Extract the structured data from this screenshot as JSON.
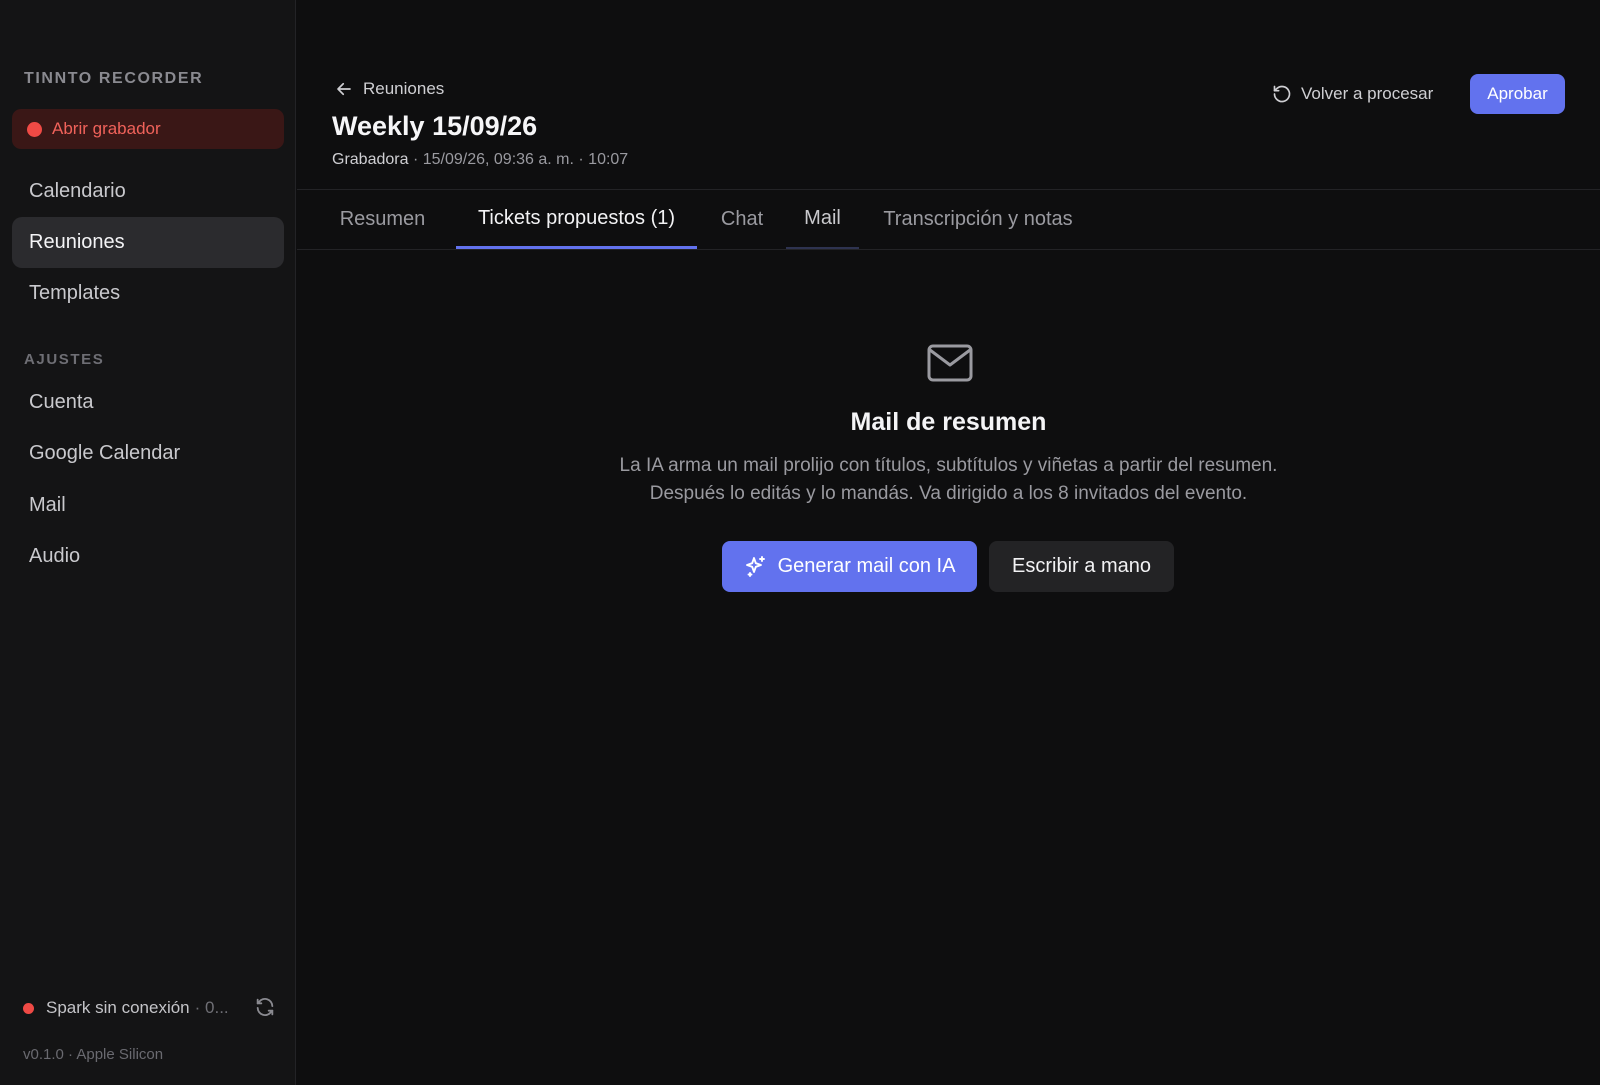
{
  "sidebar": {
    "brand": "TINNTO RECORDER",
    "record_button": "Abrir grabador",
    "nav": [
      {
        "label": "Calendario"
      },
      {
        "label": "Reuniones"
      },
      {
        "label": "Templates"
      }
    ],
    "settings_label": "AJUSTES",
    "settings": [
      {
        "label": "Cuenta"
      },
      {
        "label": "Google Calendar"
      },
      {
        "label": "Mail"
      },
      {
        "label": "Audio"
      }
    ],
    "status": {
      "text": "Spark sin conexión",
      "extra": "· 0..."
    },
    "version": "v0.1.0 · Apple Silicon",
    "active_item": "Reuniones"
  },
  "header": {
    "back_label": "Reuniones",
    "title": "Weekly 15/09/26",
    "meta_source": "Grabadora",
    "meta_rest": "· 15/09/26, 09:36 a. m. · 10:07",
    "reprocess_label": "Volver a procesar",
    "approve_label": "Aprobar"
  },
  "tabs": [
    {
      "label": "Resumen"
    },
    {
      "label": "Tickets propuestos (1)"
    },
    {
      "label": "Chat"
    },
    {
      "label": "Mail"
    },
    {
      "label": "Transcripción y notas"
    }
  ],
  "active_tab": "Tickets propuestos (1)",
  "empty_state": {
    "icon": "mail-icon",
    "title": "Mail de resumen",
    "desc_line1": "La IA arma un mail prolijo con títulos, subtítulos y viñetas a partir del resumen.",
    "desc_line2": "Después lo editás y lo mandás. Va dirigido a los 8 invitados del evento.",
    "primary_button": "Generar mail con IA",
    "secondary_button": "Escribir a mano"
  },
  "colors": {
    "accent": "#6272ee",
    "record": "#ef4a45",
    "background": "#0e0e0f",
    "sidebar": "#141415"
  }
}
